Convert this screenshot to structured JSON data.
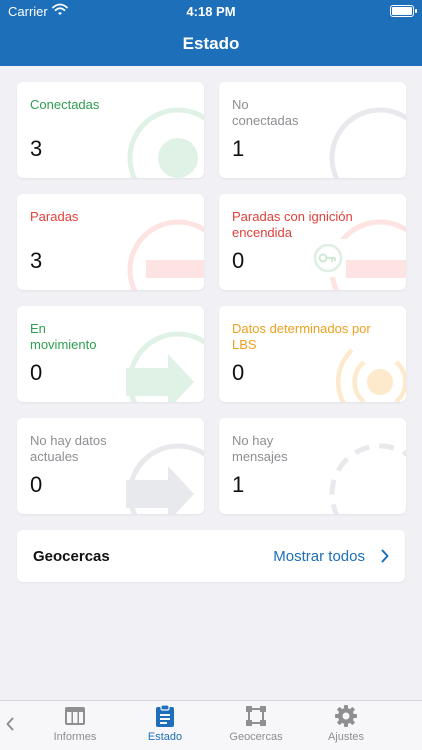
{
  "status_bar": {
    "carrier": "Carrier",
    "time": "4:18 PM"
  },
  "header": {
    "title": "Estado"
  },
  "cards": [
    {
      "label": "Conectadas",
      "count": "3",
      "color": "#2e9e4f"
    },
    {
      "label": "No conectadas",
      "count": "1",
      "color": "#8e8e93"
    },
    {
      "label": "Paradas",
      "count": "3",
      "color": "#e0413b"
    },
    {
      "label": "Paradas con ignición encendida",
      "count": "0",
      "color": "#e0413b"
    },
    {
      "label": "En movimiento",
      "count": "0",
      "color": "#2e9e4f"
    },
    {
      "label": "Datos determinados por LBS",
      "count": "0",
      "color": "#f0a020"
    },
    {
      "label": "No hay datos actuales",
      "count": "0",
      "color": "#8e8e93"
    },
    {
      "label": "No hay mensajes",
      "count": "1",
      "color": "#8e8e93"
    }
  ],
  "geofences": {
    "title": "Geocercas",
    "link": "Mostrar todos"
  },
  "tabs": [
    {
      "label": "Informes",
      "icon": "table-icon"
    },
    {
      "label": "Estado",
      "icon": "clipboard-icon"
    },
    {
      "label": "Geocercas",
      "icon": "geofence-icon"
    },
    {
      "label": "Ajustes",
      "icon": "gear-icon"
    }
  ],
  "colors": {
    "primary": "#1c6fb8",
    "background": "#f0f0f5"
  }
}
